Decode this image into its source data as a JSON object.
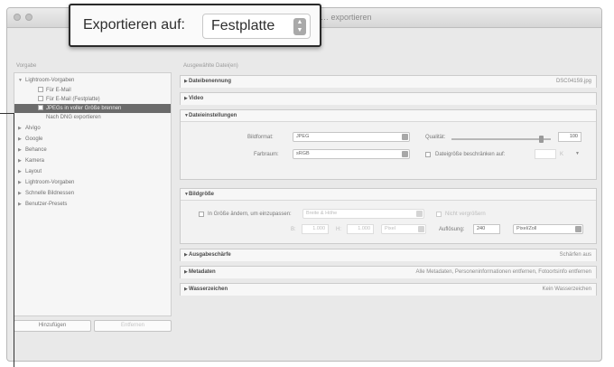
{
  "window": {
    "title": "… exportieren"
  },
  "callout": {
    "label": "Exportieren auf:",
    "value": "Festplatte"
  },
  "sidebar": {
    "heading": "Vorgabe",
    "items": [
      {
        "label": "Lightroom-Vorgaben",
        "arrow": "▼",
        "indent": 0
      },
      {
        "label": "Für E-Mail",
        "indent": 1,
        "checkbox": true
      },
      {
        "label": "Für E-Mail (Festplatte)",
        "indent": 1,
        "checkbox": true
      },
      {
        "label": "JPEGs in voller Größe brennen",
        "indent": 1,
        "checkbox": true,
        "selected": true
      },
      {
        "label": "Nach DNG exportieren",
        "indent": 1,
        "checkbox": true
      },
      {
        "label": "Alvìgo",
        "arrow": "▶",
        "indent": 0
      },
      {
        "label": "Google",
        "arrow": "▶",
        "indent": 0
      },
      {
        "label": "Behance",
        "arrow": "▶",
        "indent": 0
      },
      {
        "label": "Kamera",
        "arrow": "▶",
        "indent": 0
      },
      {
        "label": "Layout",
        "arrow": "▶",
        "indent": 0
      },
      {
        "label": "Lightroom-Vorgaben",
        "arrow": "▶",
        "indent": 0
      },
      {
        "label": "Schnelle Bildnessen",
        "arrow": "▶",
        "indent": 0
      },
      {
        "label": "Benutzer-Presets",
        "arrow": "▶",
        "indent": 0
      }
    ],
    "add_button": "Hinzufügen",
    "remove_button": "Entfernen"
  },
  "main": {
    "heading": "Ausgewählte Datei(en)",
    "sections": {
      "dateibenennung": {
        "title": "Dateibenennung",
        "summary": "DSC04159.jpg"
      },
      "video": {
        "title": "Video"
      },
      "dateieinstellungen": {
        "title": "Dateieinstellungen",
        "format_label": "Bildformat:",
        "format_value": "JPEG",
        "quality_label": "Qualität:",
        "quality_value": "100",
        "colorspace_label": "Farbraum:",
        "colorspace_value": "sRGB",
        "limit_label": "Dateigröße beschränken auf:",
        "limit_unit": "K"
      },
      "bildgroesse": {
        "title": "Bildgröße",
        "resize_label": "In Größe ändern, um einzupassen:",
        "resize_value": "Breite & Höhe",
        "no_enlarge": "Nicht vergrößern",
        "w_label": "B:",
        "w_value": "1.000",
        "h_label": "H:",
        "h_value": "1.000",
        "unit": "Pixel",
        "res_label": "Auflösung:",
        "res_value": "240",
        "res_unit": "Pixel/Zoll"
      },
      "ausgabeschaerfe": {
        "title": "Ausgabeschärfe",
        "summary": "Schärfen aus"
      },
      "metadaten": {
        "title": "Metadaten",
        "summary": "Alle Metadaten, Personeninformationen entfernen, Fotoortsinfo entfernen"
      },
      "wasserzeichen": {
        "title": "Wasserzeichen",
        "summary": "Kein Wasserzeichen"
      }
    }
  },
  "colors": {
    "selected_row": "#6b6b6b",
    "window_bg": "#e9e9e9",
    "callout_border": "#2a2a2a"
  }
}
